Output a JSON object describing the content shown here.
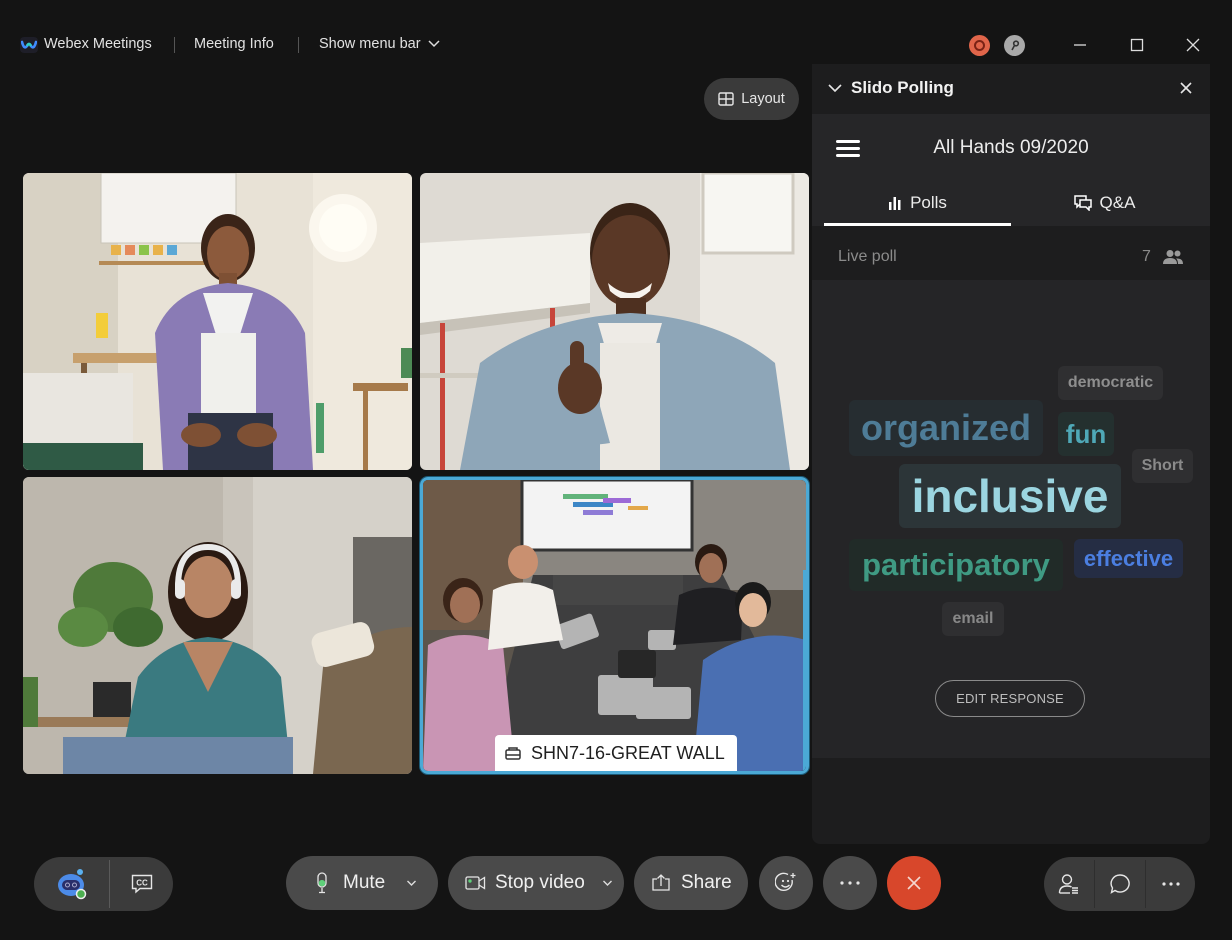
{
  "titlebar": {
    "app_name": "Webex Meetings",
    "meeting_info": "Meeting Info",
    "menu_bar": "Show menu bar",
    "icons": [
      "webex-logo-icon",
      "recording-icon",
      "key-icon",
      "minimize-icon",
      "maximize-icon",
      "close-icon"
    ]
  },
  "layout_button": {
    "label": "Layout",
    "icon": "grid-icon"
  },
  "video_tiles": [
    {
      "id": "participant-1",
      "name": ""
    },
    {
      "id": "participant-2",
      "name": ""
    },
    {
      "id": "participant-3",
      "name": ""
    },
    {
      "id": "participant-4",
      "name": "SHN7-16-GREAT WALL",
      "active_speaker": true,
      "icon": "room-device-icon"
    }
  ],
  "slido_panel": {
    "title": "Slido Polling",
    "event_title": "All Hands 09/2020",
    "tabs": [
      {
        "label": "Polls",
        "icon": "bar-chart-icon",
        "active": true
      },
      {
        "label": "Q&A",
        "icon": "chat-bubbles-icon",
        "active": false
      }
    ],
    "live_poll_label": "Live poll",
    "participant_count": "7",
    "word_cloud": [
      {
        "word": "democratic",
        "weight": 1
      },
      {
        "word": "organized",
        "weight": 3
      },
      {
        "word": "fun",
        "weight": 2
      },
      {
        "word": "Short",
        "weight": 1
      },
      {
        "word": "inclusive",
        "weight": 4
      },
      {
        "word": "participatory",
        "weight": 3
      },
      {
        "word": "effective",
        "weight": 2
      },
      {
        "word": "email",
        "weight": 1
      }
    ],
    "edit_response_label": "EDIT RESPONSE"
  },
  "controls": {
    "mute_label": "Mute",
    "stop_video_label": "Stop video",
    "share_label": "Share",
    "end_call_color": "#d8472b",
    "icons": [
      "assistant-icon",
      "closed-captions-icon",
      "microphone-icon",
      "camera-icon",
      "share-icon",
      "reactions-icon",
      "more-icon",
      "end-call-icon",
      "participants-icon",
      "chat-icon",
      "more-options-icon"
    ]
  },
  "colors": {
    "active_speaker_border": "#4ba9d6",
    "end_call": "#d8472b",
    "recording": "#e0654a"
  }
}
